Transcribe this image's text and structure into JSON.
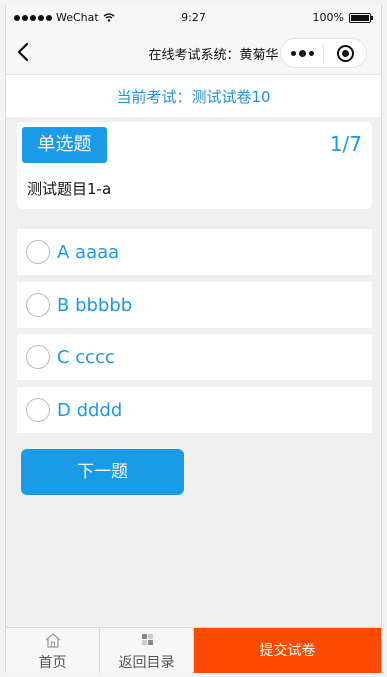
{
  "status_bar": {
    "carrier": "WeChat",
    "time": "9:27",
    "battery": "100%",
    "battery_level": 1.0
  },
  "nav": {
    "title": "在线考试系统：黄菊华"
  },
  "exam": {
    "label": "当前考试：测试试卷10"
  },
  "question": {
    "type": "单选题",
    "progress": "1/7",
    "text": "测试题目1-a"
  },
  "options": [
    {
      "label": "A aaaa"
    },
    {
      "label": "B bbbbb"
    },
    {
      "label": "C cccc"
    },
    {
      "label": "D dddd"
    }
  ],
  "next_button": "下一题",
  "tabbar": {
    "home": "首页",
    "catalog": "返回目录",
    "submit": "提交试卷"
  },
  "colors": {
    "accent": "#1a9be8",
    "submit": "#ff4b00",
    "header_text": "#2b8fd8"
  },
  "icons": {
    "back": "back-arrow-icon",
    "more": "more-dots-icon",
    "close": "target-close-icon",
    "home": "home-icon",
    "catalog": "grid-icon",
    "wifi": "wifi-icon",
    "battery": "battery-icon",
    "signal": "signal-dots-icon"
  }
}
